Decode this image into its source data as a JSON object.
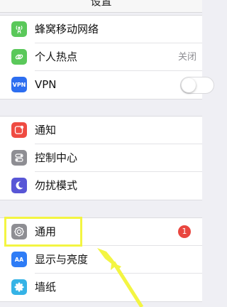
{
  "header": {
    "title": "设置"
  },
  "colors": {
    "cellular": "#5ac85a",
    "hotspot": "#5ac85a",
    "vpn": "#2d6ef0",
    "notifications": "#ef4b42",
    "control_center": "#8e8e93",
    "dnd": "#5856d6",
    "general": "#8e8e93",
    "display": "#2e7cf6",
    "wallpaper": "#35b3e6",
    "highlight": "#f3f542"
  },
  "groups": [
    {
      "items": [
        {
          "icon": "antenna-icon",
          "label": "蜂窝移动网络"
        },
        {
          "icon": "hotspot-icon",
          "label": "个人热点",
          "value": "关闭"
        },
        {
          "icon": "vpn-icon",
          "icon_text": "VPN",
          "label": "VPN",
          "toggle": false
        }
      ]
    },
    {
      "items": [
        {
          "icon": "notification-icon",
          "label": "通知"
        },
        {
          "icon": "control-center-icon",
          "label": "控制中心"
        },
        {
          "icon": "moon-icon",
          "label": "勿扰模式"
        }
      ]
    },
    {
      "items": [
        {
          "icon": "gear-icon",
          "label": "通用",
          "badge": "1"
        },
        {
          "icon": "display-icon",
          "icon_text": "AA",
          "label": "显示与亮度"
        },
        {
          "icon": "flower-icon",
          "label": "墙纸"
        }
      ]
    }
  ]
}
